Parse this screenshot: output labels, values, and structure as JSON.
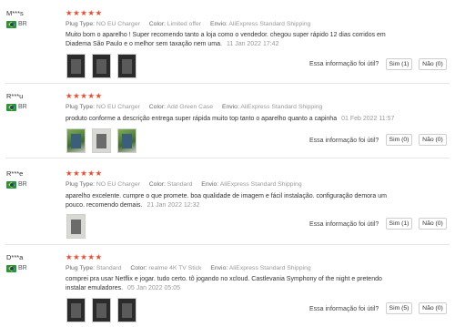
{
  "labels": {
    "plug_type": "Plug Type:",
    "color": "Color:",
    "envio": "Envio:",
    "useful_question": "Essa informação foi útil?",
    "stars": "★★★★★"
  },
  "reviews": [
    {
      "user": "M***s",
      "country": "BR",
      "rating": 5,
      "plug_type": "NO EU Charger",
      "color": "Limited offer",
      "envio": "AliExpress Standard Shipping",
      "text_lines": [
        "Muito bom o aparelho ! Super recomendo tanto a loja como o vendedor. chegou super rápido 12 dias corridos em",
        "Diadema São Paulo e o melhor sem taxação nem uma."
      ],
      "date": "11 Jan 2022 17:42",
      "yes_label": "Sim (1)",
      "no_label": "Não (0)",
      "photos": 3
    },
    {
      "user": "R***u",
      "country": "BR",
      "rating": 5,
      "plug_type": "NO EU Charger",
      "color": "Add Green Case",
      "envio": "AliExpress Standard Shipping",
      "text_lines": [
        "produto conforme a descrição entrega super rápida muito top tanto o aparelho quanto a capinha"
      ],
      "date": "01 Feb 2022 11:57",
      "yes_label": "Sim (0)",
      "no_label": "Não (0)",
      "photos": 3
    },
    {
      "user": "R***e",
      "country": "BR",
      "rating": 5,
      "plug_type": "NO EU Charger",
      "color": "Standard",
      "envio": "AliExpress Standard Shipping",
      "text_lines": [
        "aparelho excelente. cumpre o que promete. boa qualidade de imagem e fácil instalação. configuração demora um",
        "pouco. recomendo demais."
      ],
      "date": "21 Jan 2022 12:32",
      "yes_label": "Sim (1)",
      "no_label": "Não (0)",
      "photos": 1
    },
    {
      "user": "D***a",
      "country": "BR",
      "rating": 5,
      "plug_type": "Standard",
      "color": "realme 4K TV Stick",
      "envio": "AliExpress Standard Shipping",
      "text_lines": [
        "comprei pra usar Netflix e jogar. tudo certo. tô jogando no xcloud. Castlevania Symphony of the night e pretendo",
        "instalar emuladores."
      ],
      "date": "05 Jan 2022 05:05",
      "yes_label": "Sim (5)",
      "no_label": "Não (0)",
      "photos": 3
    }
  ]
}
